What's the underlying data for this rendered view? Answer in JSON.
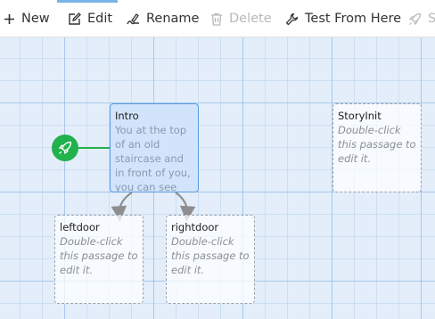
{
  "toolbar": {
    "buttons": [
      {
        "label": "New",
        "icon": "plus-icon",
        "enabled": true
      },
      {
        "label": "Edit",
        "icon": "edit-icon",
        "enabled": true
      },
      {
        "label": "Rename",
        "icon": "rename-icon",
        "enabled": true
      },
      {
        "label": "Delete",
        "icon": "trash-icon",
        "enabled": false
      },
      {
        "label": "Test From Here",
        "icon": "wrench-icon",
        "enabled": true
      },
      {
        "label": "S",
        "icon": "rocket-icon",
        "enabled": false
      }
    ]
  },
  "passages": [
    {
      "title": "Intro",
      "excerpt": "You at the top of an old staircase and in front of you, you can see two",
      "selected": true,
      "start": true
    },
    {
      "title": "StoryInit",
      "excerpt": "Double-click this passage to edit it.",
      "selected": false
    },
    {
      "title": "leftdoor",
      "excerpt": "Double-click this passage to edit it.",
      "selected": false
    },
    {
      "title": "rightdoor",
      "excerpt": "Double-click this passage to edit it.",
      "selected": false
    }
  ],
  "colors": {
    "canvas_bg": "#e3eefa",
    "selected_bg": "#d2e4fb",
    "selected_border": "#5a9be0",
    "start_green": "#22b14c",
    "link_gray": "#8e8e8e"
  }
}
